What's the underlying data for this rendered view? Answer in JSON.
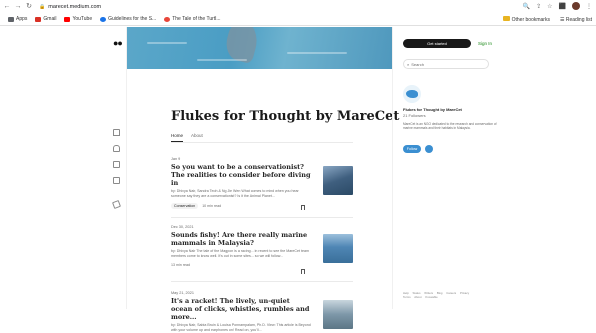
{
  "browser": {
    "url": "marecet.medium.com",
    "bookmarks": [
      {
        "label": "Apps",
        "color": "#5f6368"
      },
      {
        "label": "Gmail",
        "color": "#d93025"
      },
      {
        "label": "YouTube",
        "color": "#ff0000"
      },
      {
        "label": "Guidelines for the S...",
        "color": "#1a73e8"
      },
      {
        "label": "The Tale of the Turtl...",
        "color": "#e8463a"
      }
    ],
    "other_bookmarks": "Other bookmarks",
    "reading_list": "Reading list"
  },
  "publication": {
    "title": "Flukes for Thought by MareCet",
    "tabs": [
      "Home",
      "About"
    ]
  },
  "articles": [
    {
      "date": "Jan 9",
      "title": "So you want to be a conservationist? The realities to consider before diving in",
      "subtitle": "by: Dhivya Nair, Sandra Teoh & Ng Jie Wen What comes to mind when you hear someone say they are a conservationist? Is it the Animal Planet...",
      "tag": "Conservation",
      "read_time": "10 min read",
      "thumb_color": "#4f6f8f"
    },
    {
      "date": "Dec 30, 2021",
      "title": "Sounds fishy! Are there really marine mammals in Malaysia?",
      "subtitle": "by: Dhivya Nair The tale of the Magpon is a racing... in recent to see the MareCet team members come to know well. It's out in some sites... so we will follow...",
      "tag": "",
      "read_time": "13 min read",
      "thumb_color": "#5a8fb8"
    },
    {
      "date": "May 21, 2021",
      "title": "It's a racket! The lively, un-quiet ocean of clicks, whistles, rumbles and more...",
      "subtitle": "by: Dhivya Nair, Sabia Bruin & Louisa Ponnampalam, Ph.D. View: This article is Beyond with your volume up and earphones on! Read on, you'll...",
      "tag": "",
      "read_time": "",
      "thumb_color": "#6f8a9a"
    }
  ],
  "sidebar": {
    "get_started": "Get started",
    "sign_in": "Sign In",
    "search_placeholder": "Search",
    "pub_name": "Flukes for Thought by MareCet",
    "followers": "21 Followers",
    "description": "MareCet is an NGO dedicated to the research and conservation of marine mammals and their habitats in Malaysia.",
    "follow": "Follow",
    "footer": [
      "Help",
      "Status",
      "Writers",
      "Blog",
      "Careers",
      "Privacy",
      "Terms",
      "About",
      "Knowable"
    ]
  }
}
